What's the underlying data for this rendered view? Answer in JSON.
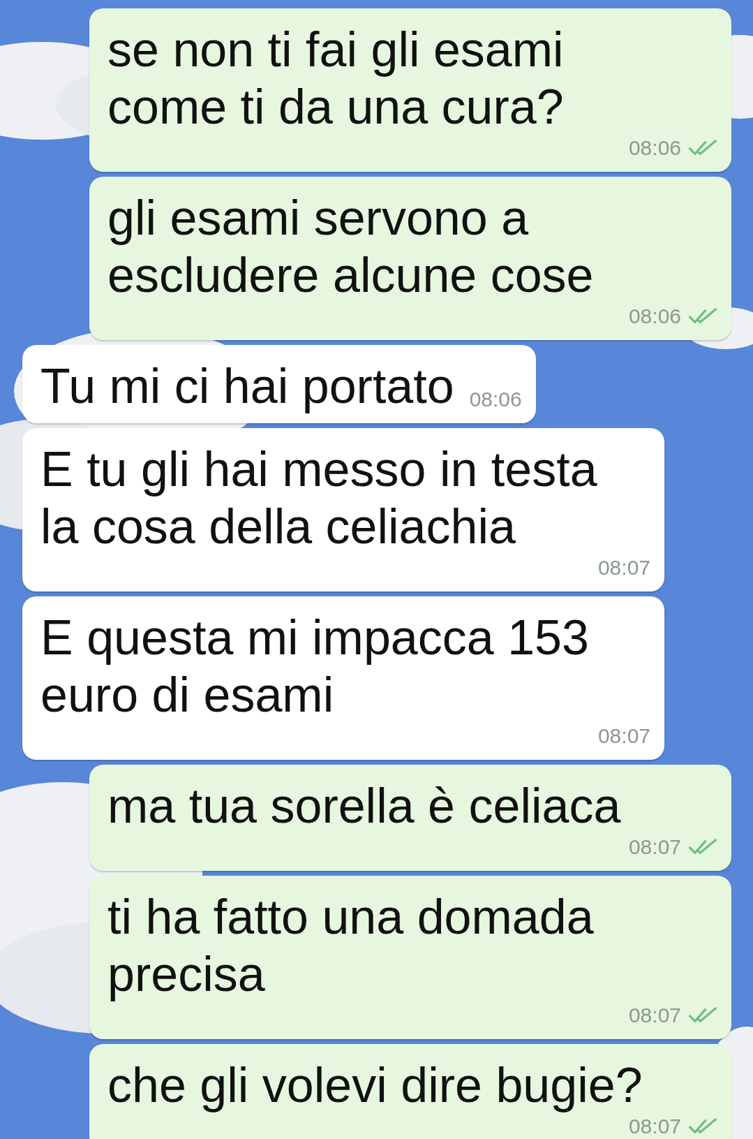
{
  "messages": [
    {
      "kind": "outgoing",
      "text": "se non ti fai gli esami come ti da una cura?",
      "time": "08:06",
      "double_check": true
    },
    {
      "kind": "outgoing",
      "text": "gli esami servono a escludere alcune cose",
      "time": "08:06",
      "double_check": true
    },
    {
      "kind": "incoming",
      "text": "Tu mi ci hai portato",
      "time": "08:06",
      "double_check": false
    },
    {
      "kind": "incoming",
      "text": "E tu gli hai messo in testa la cosa della celiachia",
      "time": "08:07",
      "double_check": false
    },
    {
      "kind": "incoming",
      "text": "E questa mi impacca 153 euro di esami",
      "time": "08:07",
      "double_check": false
    },
    {
      "kind": "outgoing",
      "text": "ma tua sorella è celiaca",
      "time": "08:07",
      "double_check": true
    },
    {
      "kind": "outgoing",
      "text": "ti ha fatto una domada precisa",
      "time": "08:07",
      "double_check": true
    },
    {
      "kind": "outgoing",
      "text": "che gli volevi dire bugie?",
      "time": "08:07",
      "double_check": true
    }
  ]
}
